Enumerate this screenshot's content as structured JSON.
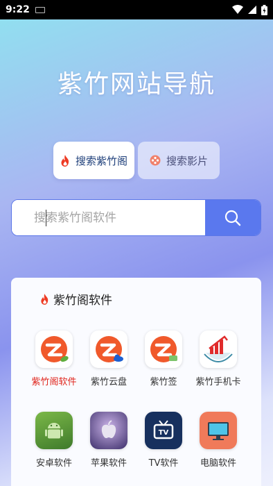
{
  "status": {
    "time": "9:22"
  },
  "title": "紫竹网站导航",
  "tabs": [
    {
      "label": "搜索紫竹阁",
      "icon": "fire-icon",
      "active": true
    },
    {
      "label": "搜索影片",
      "icon": "film-reel-icon",
      "active": false
    }
  ],
  "search": {
    "placeholder": "搜索紫竹阁软件",
    "button_icon": "search-icon"
  },
  "panel": {
    "title": "紫竹阁软件",
    "apps": [
      {
        "label": "紫竹阁软件",
        "icon": "zizhu-ge-icon",
        "highlight": true
      },
      {
        "label": "紫竹云盘",
        "icon": "zizhu-cloud-icon"
      },
      {
        "label": "紫竹签",
        "icon": "zizhu-sign-icon"
      },
      {
        "label": "紫竹手机卡",
        "icon": "zizhu-simcard-icon"
      },
      {
        "label": "安卓软件",
        "icon": "android-icon"
      },
      {
        "label": "苹果软件",
        "icon": "apple-icon"
      },
      {
        "label": "TV软件",
        "icon": "tv-icon"
      },
      {
        "label": "电脑软件",
        "icon": "monitor-icon"
      }
    ]
  },
  "colors": {
    "accent": "#5a78ee",
    "fire": "#ee3b24",
    "brand_orange": "#f0592b"
  }
}
